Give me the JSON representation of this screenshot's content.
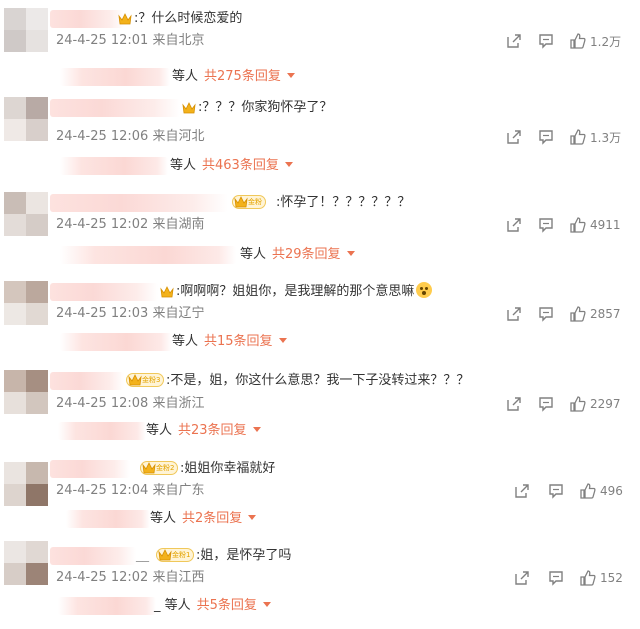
{
  "colors": {
    "accent": "#eb7350",
    "meta": "#808080",
    "text": "#333333",
    "badge": "#f0c85a"
  },
  "comments": [
    {
      "text": ":？什么时候恋爱的",
      "time": "24-4-25 12:01",
      "source": "来自北京",
      "likes": "1.2万",
      "reply_who": "等人",
      "reply_total": "共275条回复",
      "badge": ""
    },
    {
      "text": ":？？？你家狗怀孕了？",
      "time": "24-4-25 12:06",
      "source": "来自河北",
      "likes": "1.3万",
      "reply_who": "等人",
      "reply_total": "共463条回复",
      "badge": ""
    },
    {
      "text": ":怀孕了！？？？？？？",
      "time": "24-4-25 12:02",
      "source": "来自湖南",
      "likes": "4911",
      "reply_who": "等人",
      "reply_total": "共29条回复",
      "badge": "金粉"
    },
    {
      "text": ":啊啊啊？姐姐你，是我理解的那个意思嘛",
      "time": "24-4-25 12:03",
      "source": "来自辽宁",
      "likes": "2857",
      "reply_who": "等人",
      "reply_total": "共15条回复",
      "badge": ""
    },
    {
      "text": ":不是，姐，你这什么意思？我一下子没转过来？？？",
      "time": "24-4-25 12:08",
      "source": "来自浙江",
      "likes": "2297",
      "reply_who": "等人",
      "reply_total": "共23条回复",
      "badge": "金粉3"
    },
    {
      "text": ":姐姐你幸福就好",
      "time": "24-4-25 12:04",
      "source": "来自广东",
      "likes": "496",
      "reply_who": "等人",
      "reply_total": "共2条回复",
      "badge": "金粉2"
    },
    {
      "text": ":姐，是怀孕了吗",
      "time": "24-4-25 12:02",
      "source": "来自江西",
      "likes": "152",
      "reply_who": "_ 等人",
      "reply_total": "共5条回复",
      "badge": "金粉1"
    }
  ],
  "icons": {
    "share": "share-icon",
    "comment": "comment-icon",
    "like": "like-icon",
    "crown": "crown-icon",
    "expand": "caret-down-icon"
  }
}
